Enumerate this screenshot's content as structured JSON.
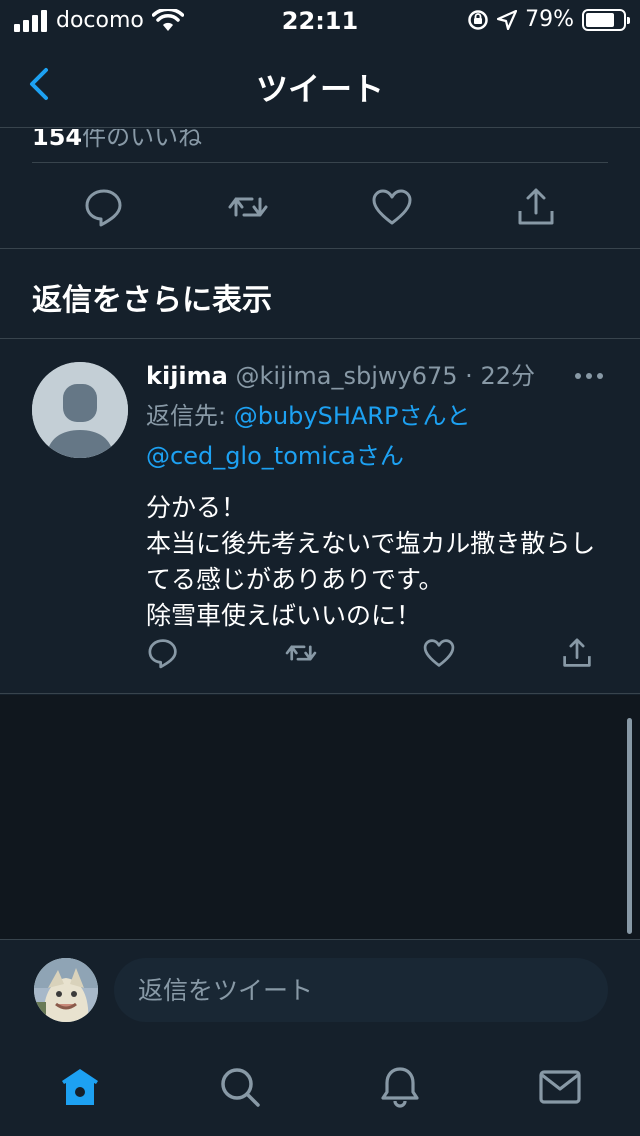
{
  "status_bar": {
    "carrier": "docomo",
    "time": "22:11",
    "battery": "79%",
    "battery_level": 0.79
  },
  "nav": {
    "title": "ツイート",
    "back_icon": "chevron-left-icon"
  },
  "previous_tweet": {
    "likes_count": "154",
    "likes_label": "件のいいね",
    "actions": [
      "reply-icon",
      "retweet-icon",
      "like-icon",
      "share-icon"
    ]
  },
  "more_replies": {
    "label": "返信をさらに表示"
  },
  "reply": {
    "name": "kijima",
    "handle": "@kijima_sbjwy675",
    "separator": "·",
    "time": "22分",
    "reply_to_prefix": "返信先: ",
    "mention1": "@bubySHARPさんと",
    "mention2": "@ced_glo_tomicaさん",
    "text": "分かる！\n本当に後先考えないで塩カル撒き散らしてる感じがありありです。\n除雪車使えばいいのに！"
  },
  "compose": {
    "placeholder": "返信をツイート"
  },
  "tab_bar": {
    "tabs": [
      "home-icon",
      "search-icon",
      "notifications-icon",
      "messages-icon"
    ],
    "active": "home-icon"
  },
  "colors": {
    "background": "#15202b",
    "accent": "#1da1f2",
    "secondary_text": "#8899a6",
    "divider": "#38444d"
  }
}
